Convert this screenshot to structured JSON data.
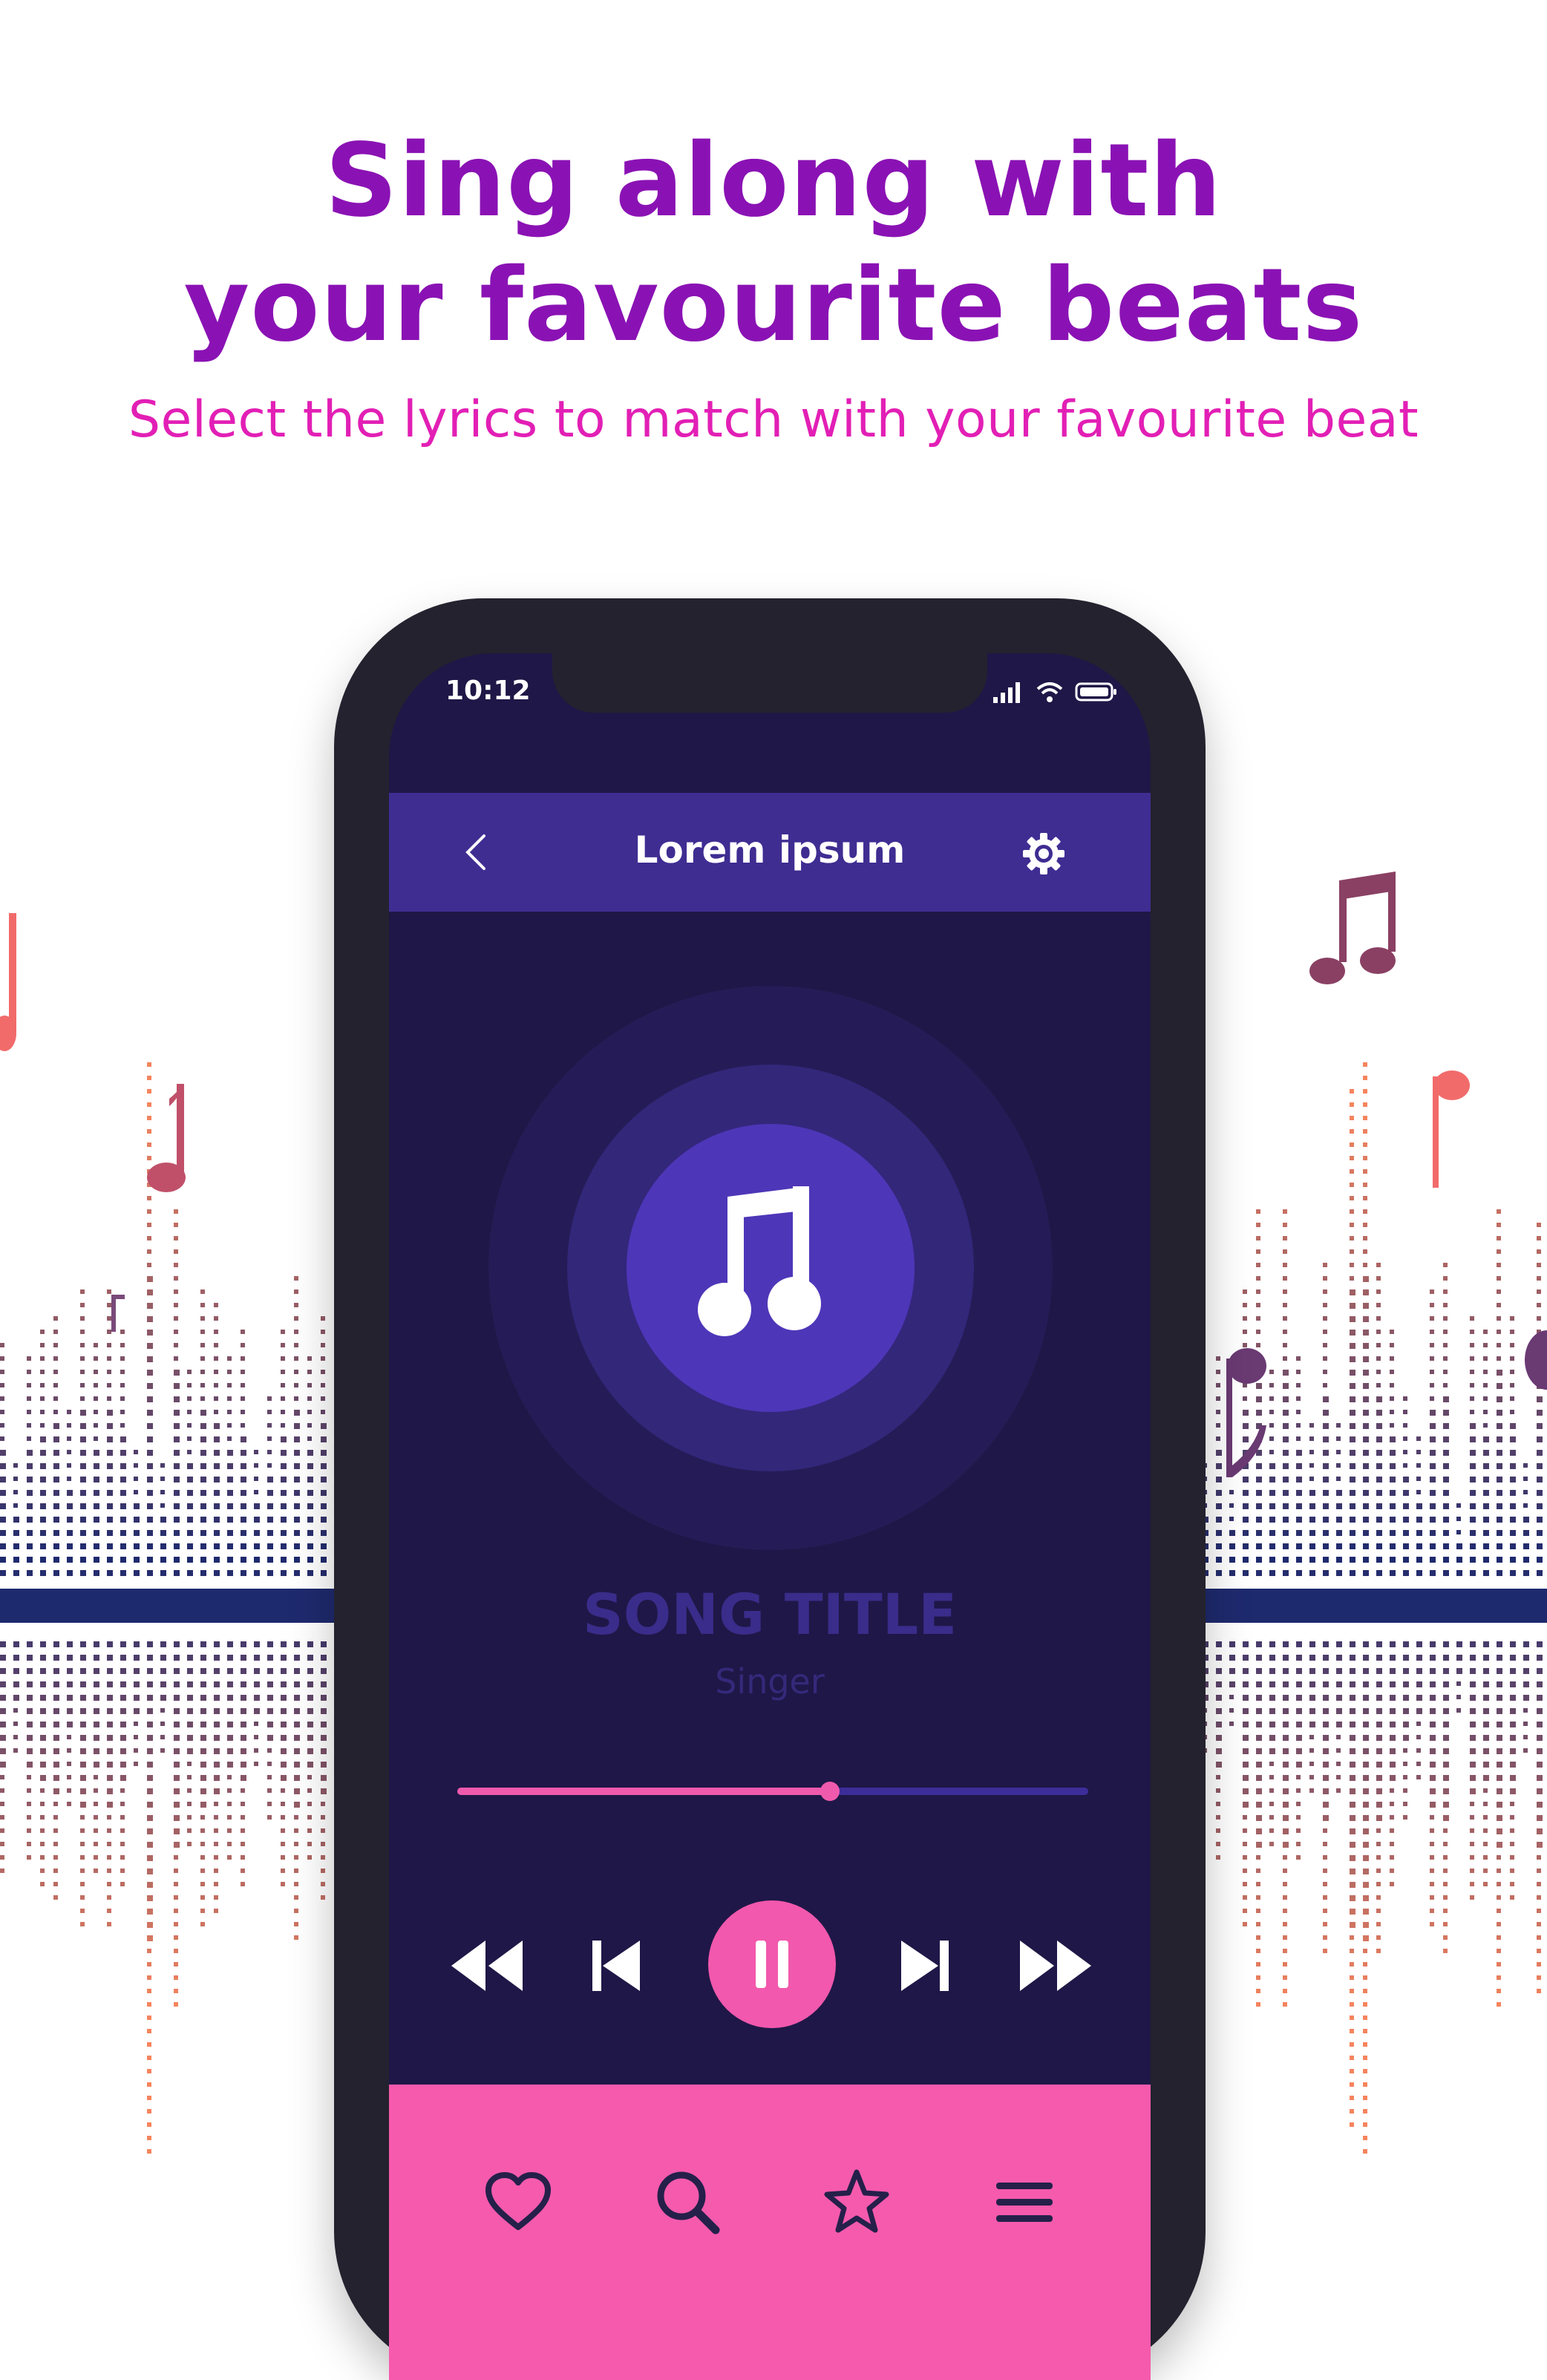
{
  "headline": {
    "line1": "Sing along with",
    "line2": "your favourite beats",
    "subtitle": "Select the lyrics to match with your favourite beat"
  },
  "status_bar": {
    "time": "10:12",
    "icons": [
      "signal-icon",
      "wifi-icon",
      "battery-icon"
    ]
  },
  "app_bar": {
    "title": "Lorem ipsum",
    "back_icon": "chevron-left-icon",
    "settings_icon": "gear-icon"
  },
  "now_playing": {
    "artwork_icon": "music-note-icon",
    "song_title": "SONG TITLE",
    "singer": "Singer",
    "progress": 0.59
  },
  "controls": [
    "rewind-icon",
    "skip-previous-icon",
    "pause-icon",
    "skip-next-icon",
    "fast-forward-icon"
  ],
  "bottom_nav": [
    "heart-icon",
    "search-icon",
    "star-icon",
    "menu-icon"
  ],
  "colors": {
    "headline": "#8a12b4",
    "subtitle": "#e21fb5",
    "phone_frame": "#24222e",
    "screen_bg": "#1f1747",
    "app_bar": "#3f2d92",
    "accent_pink": "#f258ad",
    "progress_track": "#3d2d99",
    "eq_center": "#1e2a6e",
    "eq_edge": "#f5845e"
  }
}
